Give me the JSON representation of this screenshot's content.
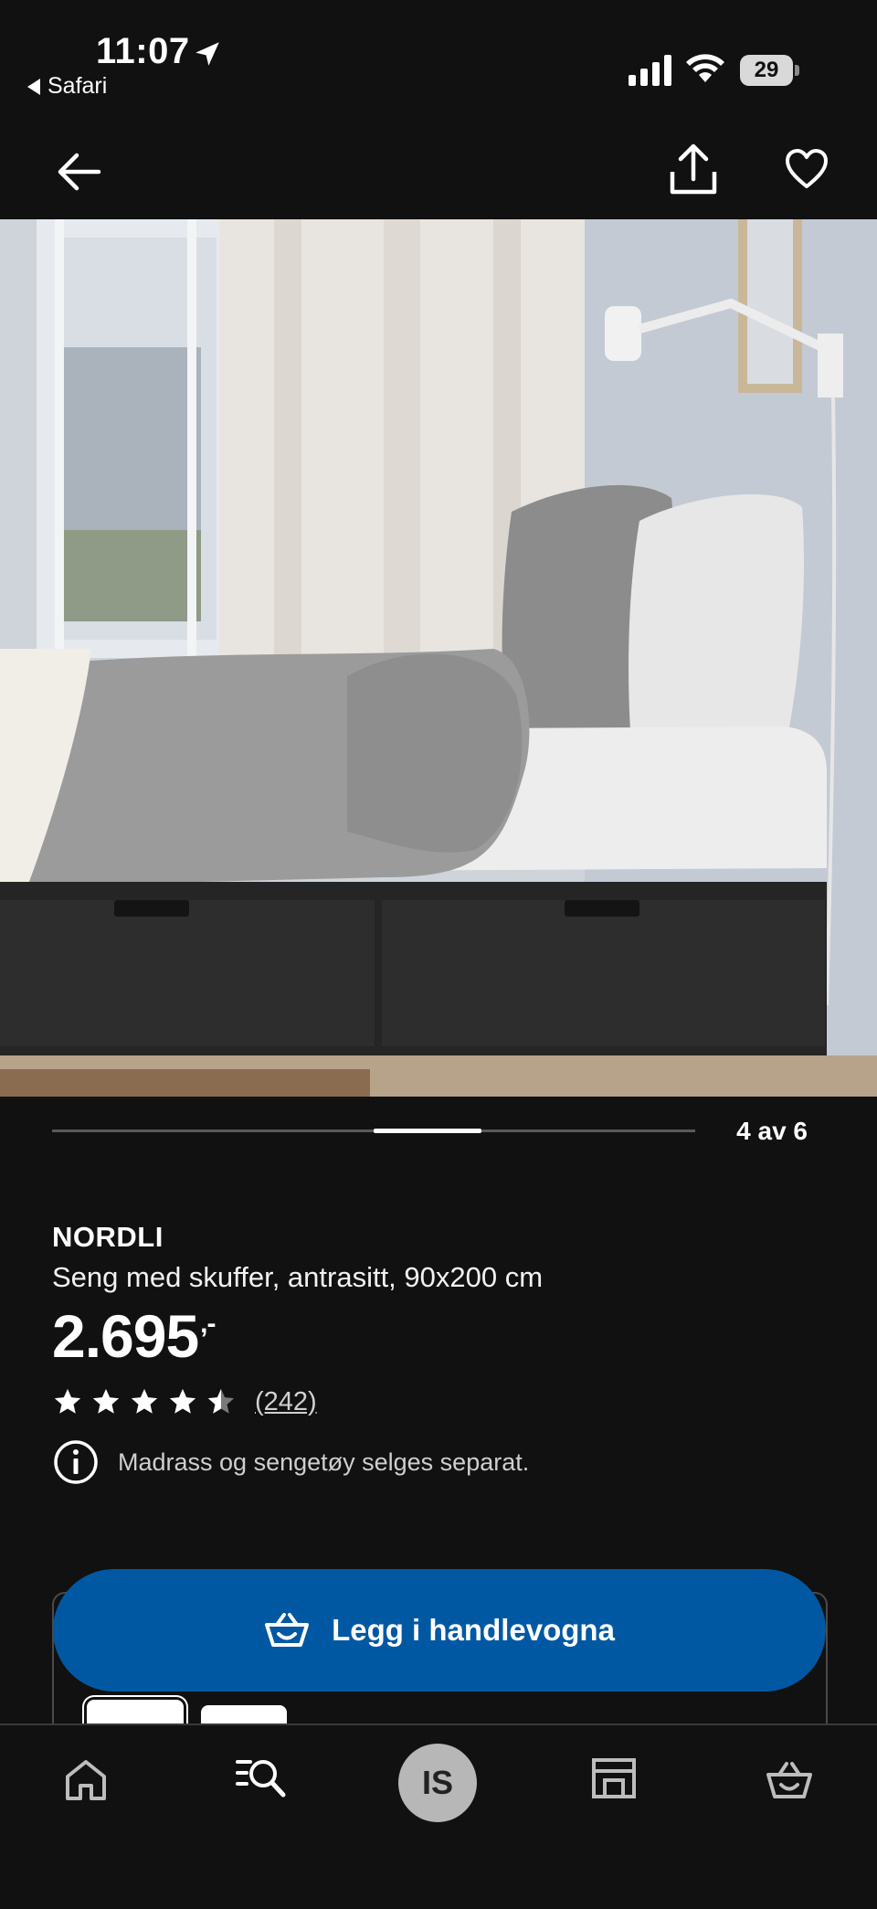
{
  "status_bar": {
    "time": "11:07",
    "back_app": "Safari",
    "battery": "29"
  },
  "carousel": {
    "counter": "4 av 6"
  },
  "product": {
    "brand": "NORDLI",
    "description": "Seng med skuffer, antrasitt, 90x200 cm",
    "price": "2.695",
    "price_suffix": ",-",
    "rating": 4.5,
    "reviews": "(242)",
    "notice": "Madrass og sengetøy selges separat."
  },
  "actions": {
    "add_to_cart": "Legg i handlevogna"
  },
  "tabbar": {
    "profile_initials": "IS"
  }
}
